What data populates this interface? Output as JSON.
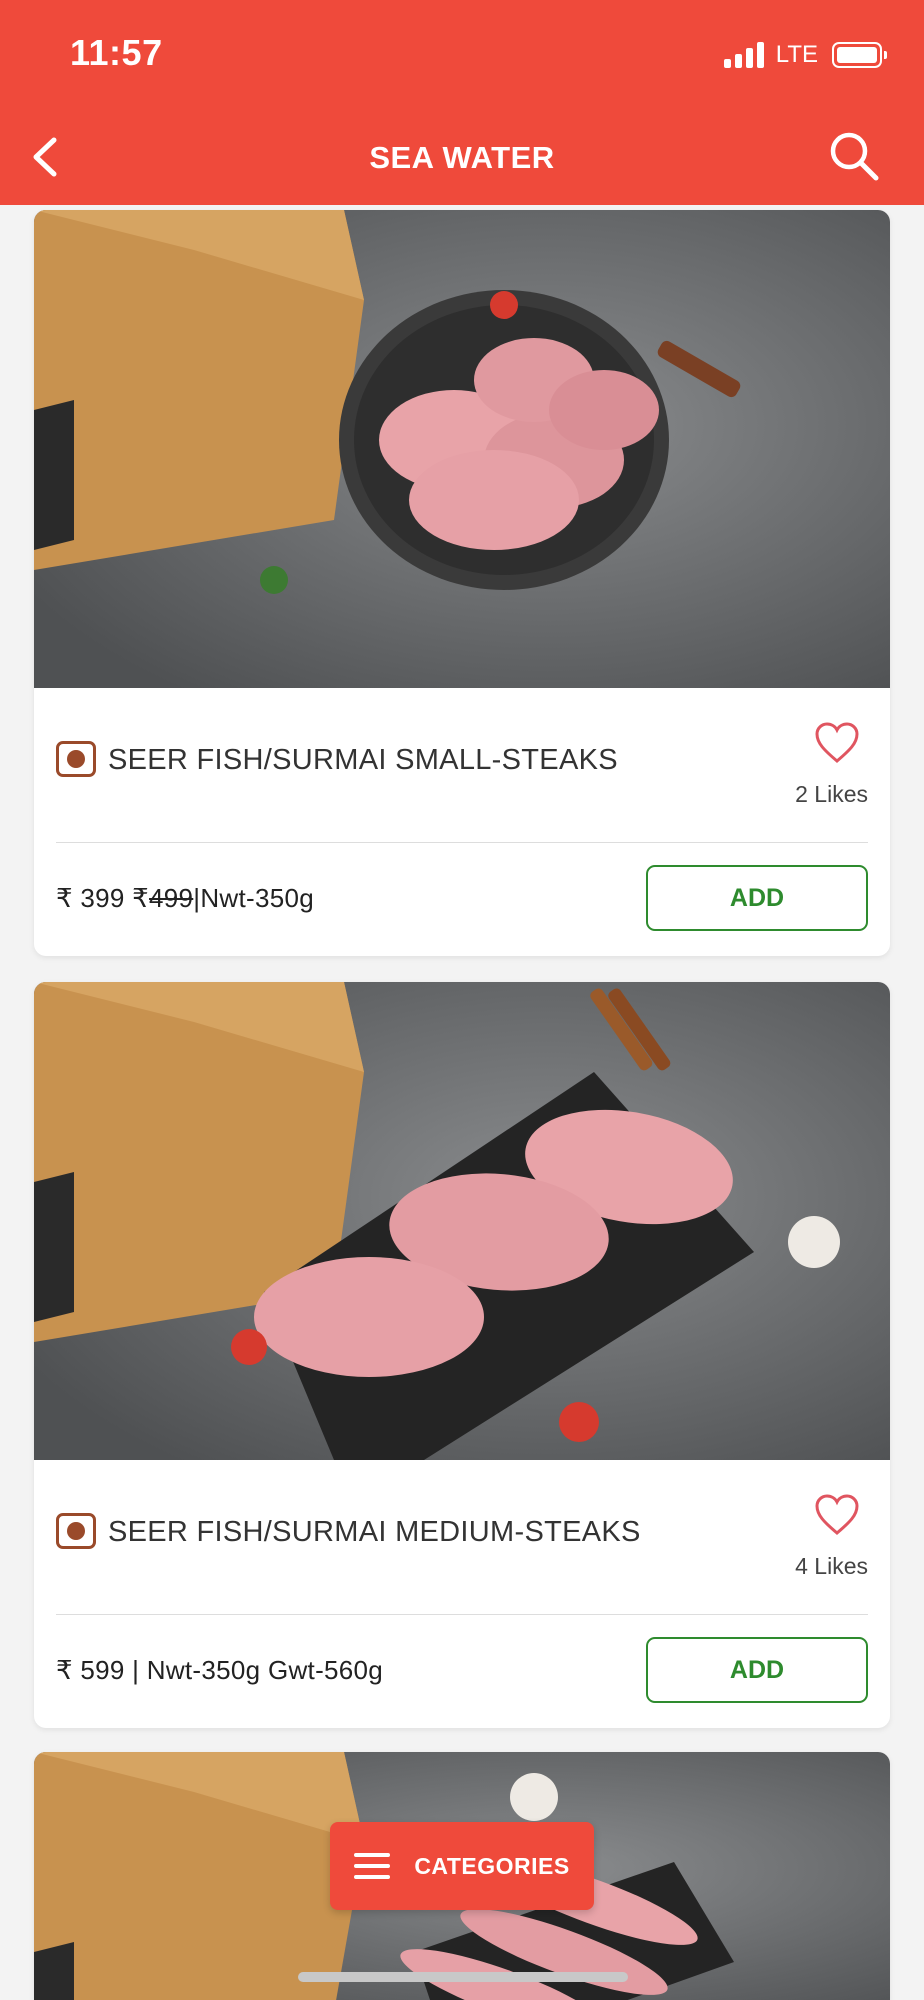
{
  "status_bar": {
    "time": "11:57",
    "network": "LTE"
  },
  "header": {
    "title": "SEA WATER",
    "back_icon": "chevron-left-icon",
    "search_icon": "search-icon"
  },
  "products": [
    {
      "name": "SEER FISH/SURMAI SMALL-STEAKS",
      "likes": "2 Likes",
      "price_prefix": "₹ 399 ₹",
      "price_strike": "499",
      "price_suffix": "|Nwt-350g",
      "add_label": "ADD"
    },
    {
      "name": "SEER FISH/SURMAI MEDIUM-STEAKS",
      "likes": "4 Likes",
      "price_prefix": "₹ 599 | Nwt-350g Gwt-560g",
      "price_strike": "",
      "price_suffix": "",
      "add_label": "ADD"
    }
  ],
  "categories_button": {
    "label": "CATEGORIES",
    "icon": "menu-icon"
  },
  "colors": {
    "brand": "#ef4a3b",
    "add_green": "#2e8b2e",
    "veg_mark": "#9a4a2a",
    "heart": "#e05560"
  }
}
